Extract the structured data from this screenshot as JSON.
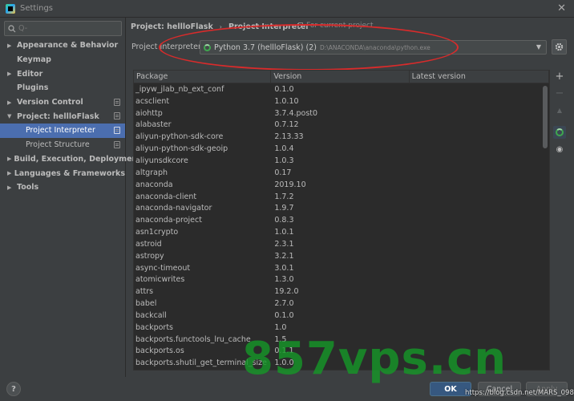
{
  "window": {
    "title": "Settings"
  },
  "sidebar": {
    "search_placeholder": "Q-",
    "items": [
      {
        "label": "Appearance & Behavior",
        "arrow": "▶",
        "bold": true
      },
      {
        "label": "Keymap",
        "arrow": "",
        "bold": true
      },
      {
        "label": "Editor",
        "arrow": "▶",
        "bold": true
      },
      {
        "label": "Plugins",
        "arrow": "",
        "bold": true
      },
      {
        "label": "Version Control",
        "arrow": "▶",
        "bold": true
      },
      {
        "label": "Project: hellloFlask",
        "arrow": "▼",
        "bold": true
      },
      {
        "label": "Project Interpreter",
        "sub": true,
        "selected": true
      },
      {
        "label": "Project Structure",
        "sub": true
      },
      {
        "label": "Build, Execution, Deployment",
        "arrow": "▶",
        "bold": true
      },
      {
        "label": "Languages & Frameworks",
        "arrow": "▶",
        "bold": true
      },
      {
        "label": "Tools",
        "arrow": "▶",
        "bold": true
      }
    ]
  },
  "breadcrumb": {
    "project": "Project: hellloFlask",
    "separator": "›",
    "page": "Project Interpreter",
    "scope_note": "For current project"
  },
  "interpreter": {
    "label": "Project Interpreter:",
    "name": "Python 3.7 (hellloFlask) (2)",
    "path": "D:\\ANACONDA\\anaconda\\python.exe"
  },
  "table": {
    "headers": [
      "Package",
      "Version",
      "Latest version"
    ],
    "rows": [
      [
        "_ipyw_jlab_nb_ext_conf",
        "0.1.0"
      ],
      [
        "acsclient",
        "1.0.10"
      ],
      [
        "aiohttp",
        "3.7.4.post0"
      ],
      [
        "alabaster",
        "0.7.12"
      ],
      [
        "aliyun-python-sdk-core",
        "2.13.33"
      ],
      [
        "aliyun-python-sdk-geoip",
        "1.0.4"
      ],
      [
        "aliyunsdkcore",
        "1.0.3"
      ],
      [
        "altgraph",
        "0.17"
      ],
      [
        "anaconda",
        "2019.10"
      ],
      [
        "anaconda-client",
        "1.7.2"
      ],
      [
        "anaconda-navigator",
        "1.9.7"
      ],
      [
        "anaconda-project",
        "0.8.3"
      ],
      [
        "asn1crypto",
        "1.0.1"
      ],
      [
        "astroid",
        "2.3.1"
      ],
      [
        "astropy",
        "3.2.1"
      ],
      [
        "async-timeout",
        "3.0.1"
      ],
      [
        "atomicwrites",
        "1.3.0"
      ],
      [
        "attrs",
        "19.2.0"
      ],
      [
        "babel",
        "2.7.0"
      ],
      [
        "backcall",
        "0.1.0"
      ],
      [
        "backports",
        "1.0"
      ],
      [
        "backports.functools_lru_cache",
        "1.5"
      ],
      [
        "backports.os",
        "0.1.1"
      ],
      [
        "backports.shutil_get_terminal_size",
        "1.0.0"
      ]
    ]
  },
  "tools": {
    "add": "+",
    "remove": "−",
    "upgrade": "▲",
    "show": "◉"
  },
  "buttons": {
    "help": "?",
    "ok": "OK",
    "cancel": "Cancel",
    "apply": "Apply"
  },
  "overlay": {
    "watermark": "857vps.cn",
    "url": "https://blog.csdn.net/MARS_098"
  },
  "colors": {
    "background": "#3c3f41",
    "table_bg": "#2b2b2b",
    "selected": "#4b6eaf",
    "annotation_ellipse": "#d92b2b",
    "watermark": "#169628"
  }
}
